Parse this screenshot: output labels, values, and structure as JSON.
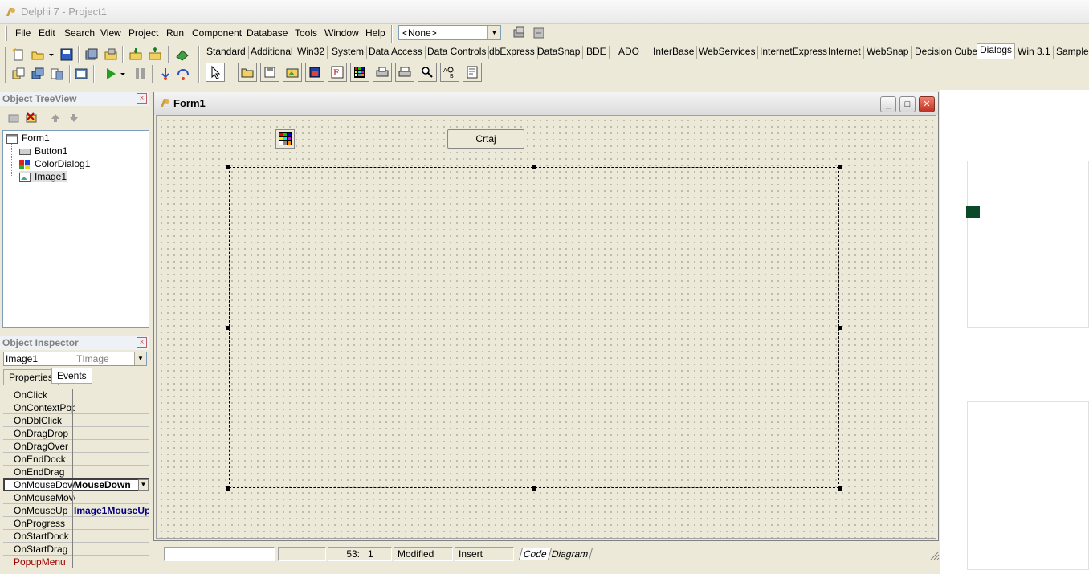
{
  "window": {
    "title": "Delphi 7 - Project1"
  },
  "menu": [
    "File",
    "Edit",
    "Search",
    "View",
    "Project",
    "Run",
    "Component",
    "Database",
    "Tools",
    "Window",
    "Help"
  ],
  "project_combo": {
    "value": "<None>"
  },
  "palette": {
    "tabs": [
      "Standard",
      "Additional",
      "Win32",
      "System",
      "Data Access",
      "Data Controls",
      "dbExpress",
      "DataSnap",
      "BDE",
      "ADO",
      "InterBase",
      "WebServices",
      "InternetExpress",
      "Internet",
      "WebSnap",
      "Decision Cube",
      "Dialogs",
      "Win 3.1",
      "Samples"
    ],
    "active_tab": "Dialogs"
  },
  "tree_view": {
    "title": "Object TreeView",
    "root": "Form1",
    "children": [
      "Button1",
      "ColorDialog1",
      "Image1"
    ]
  },
  "object_inspector": {
    "title": "Object Inspector",
    "object_name": "Image1",
    "object_type": "TImage",
    "tabs": [
      "Properties",
      "Events"
    ],
    "active_tab": "Events",
    "events": [
      {
        "name": "OnClick",
        "value": ""
      },
      {
        "name": "OnContextPopup",
        "value": ""
      },
      {
        "name": "OnDblClick",
        "value": ""
      },
      {
        "name": "OnDragDrop",
        "value": ""
      },
      {
        "name": "OnDragOver",
        "value": ""
      },
      {
        "name": "OnEndDock",
        "value": ""
      },
      {
        "name": "OnEndDrag",
        "value": ""
      },
      {
        "name": "OnMouseDown",
        "value": "MouseDown"
      },
      {
        "name": "OnMouseMove",
        "value": ""
      },
      {
        "name": "OnMouseUp",
        "value": "Image1MouseUp"
      },
      {
        "name": "OnProgress",
        "value": ""
      },
      {
        "name": "OnStartDock",
        "value": ""
      },
      {
        "name": "OnStartDrag",
        "value": ""
      },
      {
        "name": "PopupMenu",
        "value": ""
      }
    ]
  },
  "form": {
    "title": "Form1",
    "button_caption": "Crtaj"
  },
  "editor_status": {
    "position": "53:   1",
    "modified": "Modified",
    "mode": "Insert",
    "tabs": [
      "Code",
      "Diagram"
    ]
  }
}
